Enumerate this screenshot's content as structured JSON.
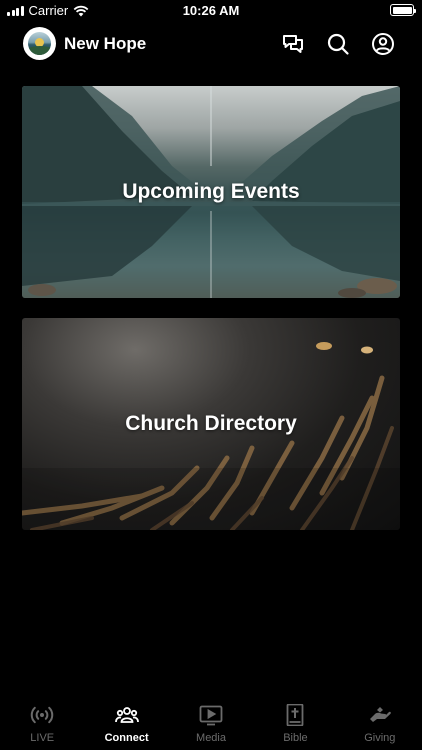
{
  "status_bar": {
    "carrier": "Carrier",
    "time": "10:26 AM"
  },
  "header": {
    "title": "New Hope"
  },
  "cards": [
    {
      "title": "Upcoming Events"
    },
    {
      "title": "Church Directory"
    }
  ],
  "tabs": [
    {
      "label": "LIVE",
      "icon": "live-broadcast-icon",
      "active": false
    },
    {
      "label": "Connect",
      "icon": "people-icon",
      "active": true
    },
    {
      "label": "Media",
      "icon": "play-screen-icon",
      "active": false
    },
    {
      "label": "Bible",
      "icon": "bible-cross-icon",
      "active": false
    },
    {
      "label": "Giving",
      "icon": "giving-hand-icon",
      "active": false
    }
  ],
  "colors": {
    "background": "#000000",
    "active_tab": "#ffffff",
    "inactive_tab": "#6b6b6b"
  }
}
